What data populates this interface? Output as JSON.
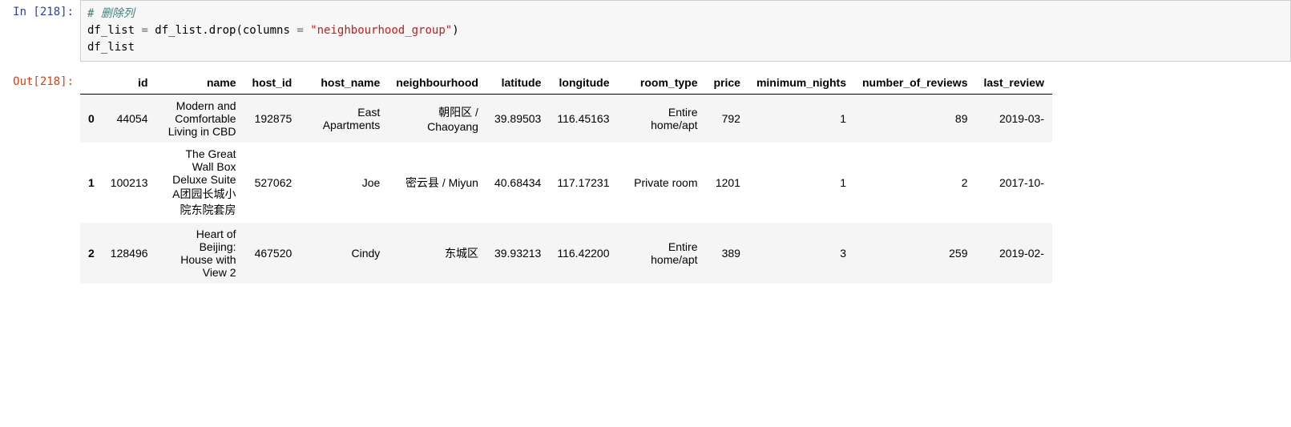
{
  "input": {
    "prompt": "In [218]:",
    "code_line1": "# 删除列",
    "code_line2a": "df_list ",
    "code_line2b": "=",
    "code_line2c": " df_list.drop(columns ",
    "code_line2d": "=",
    "code_line2e": " ",
    "code_line2f": "\"neighbourhood_group\"",
    "code_line2g": ")",
    "code_line3": "df_list"
  },
  "output": {
    "prompt": "Out[218]:",
    "columns": [
      "",
      "id",
      "name",
      "host_id",
      "host_name",
      "neighbourhood",
      "latitude",
      "longitude",
      "room_type",
      "price",
      "minimum_nights",
      "number_of_reviews",
      "last_review"
    ],
    "rows": [
      {
        "idx": "0",
        "id": "44054",
        "name": "Modern and Comfortable Living in CBD",
        "host_id": "192875",
        "host_name": "East Apartments",
        "neighbourhood": "朝阳区 / Chaoyang",
        "latitude": "39.89503",
        "longitude": "116.45163",
        "room_type": "Entire home/apt",
        "price": "792",
        "minimum_nights": "1",
        "number_of_reviews": "89",
        "last_review": "2019-03-"
      },
      {
        "idx": "1",
        "id": "100213",
        "name": "The Great Wall Box Deluxe Suite A团园长城小院东院套房",
        "host_id": "527062",
        "host_name": "Joe",
        "neighbourhood": "密云县 / Miyun",
        "latitude": "40.68434",
        "longitude": "117.17231",
        "room_type": "Private room",
        "price": "1201",
        "minimum_nights": "1",
        "number_of_reviews": "2",
        "last_review": "2017-10-"
      },
      {
        "idx": "2",
        "id": "128496",
        "name": "Heart of Beijing: House with View 2",
        "host_id": "467520",
        "host_name": "Cindy",
        "neighbourhood": "东城区",
        "latitude": "39.93213",
        "longitude": "116.42200",
        "room_type": "Entire home/apt",
        "price": "389",
        "minimum_nights": "3",
        "number_of_reviews": "259",
        "last_review": "2019-02-"
      }
    ]
  }
}
